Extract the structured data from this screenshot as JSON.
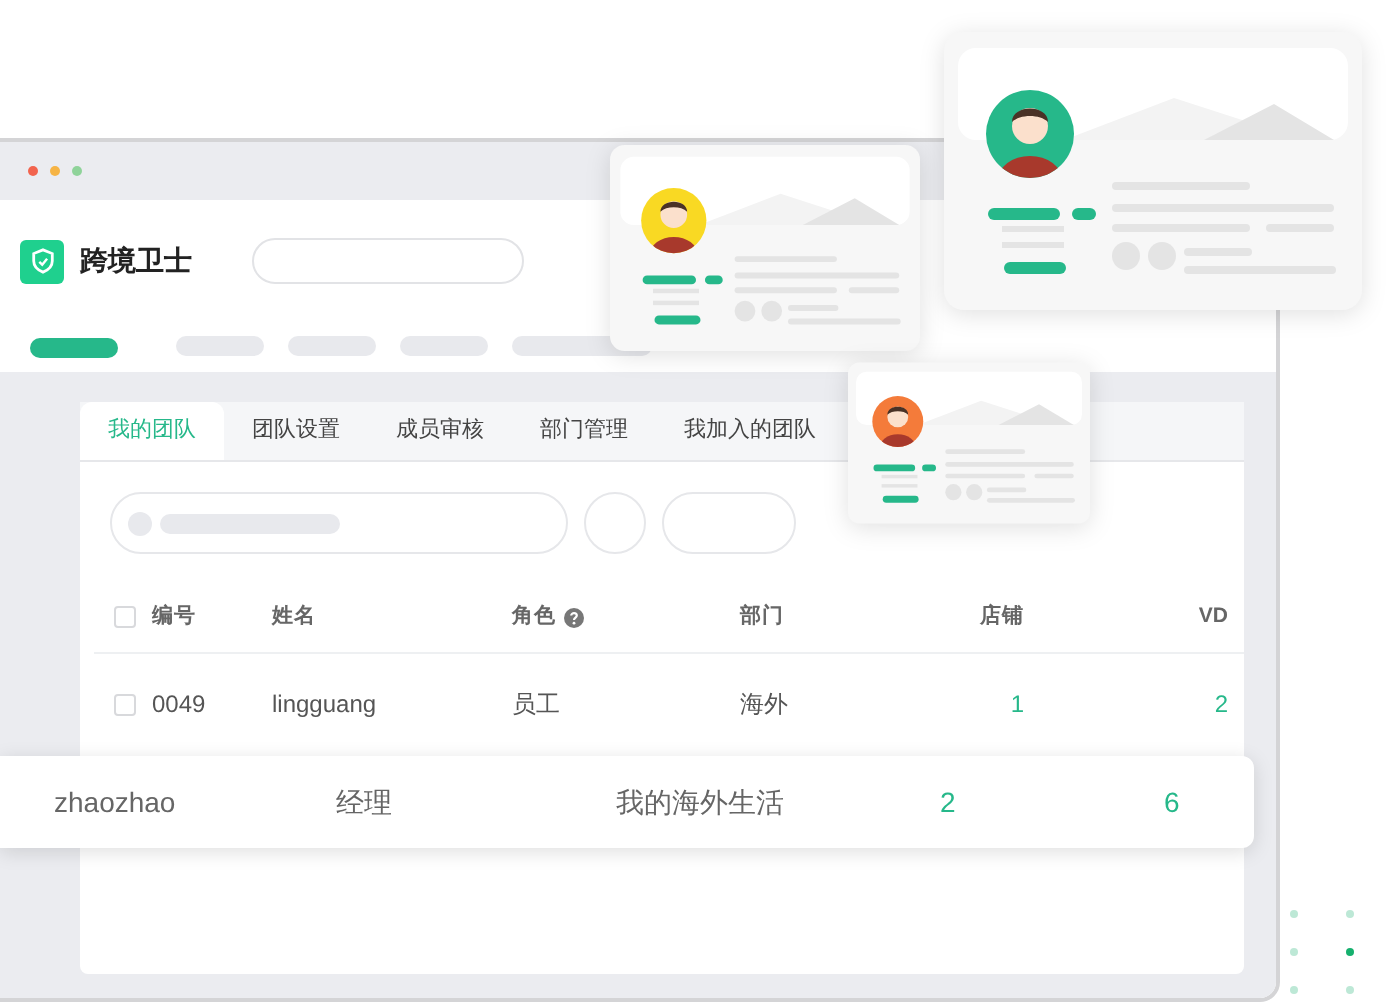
{
  "app": {
    "title": "跨境卫士"
  },
  "tabs": [
    {
      "label": "我的团队",
      "selected": true
    },
    {
      "label": "团队设置",
      "selected": false
    },
    {
      "label": "成员审核",
      "selected": false
    },
    {
      "label": "部门管理",
      "selected": false
    },
    {
      "label": "我加入的团队",
      "selected": false
    }
  ],
  "table": {
    "select_all_checked": false,
    "columns": [
      {
        "label": "编号",
        "help": false
      },
      {
        "label": "姓名",
        "help": false
      },
      {
        "label": "角色",
        "help": true
      },
      {
        "label": "部门",
        "help": false
      },
      {
        "label": "店铺",
        "help": false
      },
      {
        "label": "VD",
        "help": false
      }
    ],
    "rows": [
      {
        "highlighted": false,
        "checked": false,
        "cells": [
          "0049",
          "lingguang",
          "员工",
          "海外",
          "1",
          "2"
        ]
      },
      {
        "highlighted": true,
        "cells": [
          "",
          "zhaozhao",
          "经理",
          "我的海外生活",
          "2",
          "6"
        ]
      }
    ]
  },
  "profile_cards": [
    {
      "color": "#f9d923"
    },
    {
      "color": "#26b88a"
    },
    {
      "color": "#f47b3a"
    }
  ]
}
